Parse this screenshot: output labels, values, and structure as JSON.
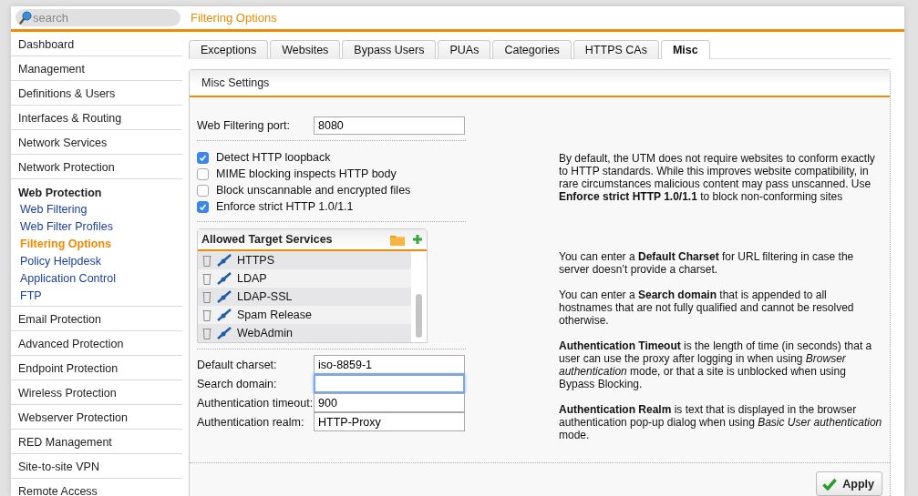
{
  "search": {
    "placeholder": "search"
  },
  "page_title": "Filtering Options",
  "sidebar": {
    "items": [
      {
        "label": "Dashboard",
        "expanded": false
      },
      {
        "label": "Management",
        "expanded": false
      },
      {
        "label": "Definitions & Users",
        "expanded": false
      },
      {
        "label": "Interfaces & Routing",
        "expanded": false
      },
      {
        "label": "Network Services",
        "expanded": false
      },
      {
        "label": "Network Protection",
        "expanded": false
      },
      {
        "label": "Web Protection",
        "expanded": true,
        "children": [
          {
            "label": "Web Filtering",
            "selected": false
          },
          {
            "label": "Web Filter Profiles",
            "selected": false
          },
          {
            "label": "Filtering Options",
            "selected": true
          },
          {
            "label": "Policy Helpdesk",
            "selected": false
          },
          {
            "label": "Application Control",
            "selected": false
          },
          {
            "label": "FTP",
            "selected": false
          }
        ]
      },
      {
        "label": "Email Protection",
        "expanded": false
      },
      {
        "label": "Advanced Protection",
        "expanded": false
      },
      {
        "label": "Endpoint Protection",
        "expanded": false
      },
      {
        "label": "Wireless Protection",
        "expanded": false
      },
      {
        "label": "Webserver Protection",
        "expanded": false
      },
      {
        "label": "RED Management",
        "expanded": false
      },
      {
        "label": "Site-to-site VPN",
        "expanded": false
      },
      {
        "label": "Remote Access",
        "expanded": false
      }
    ]
  },
  "tabs": [
    {
      "label": "Exceptions",
      "selected": false
    },
    {
      "label": "Websites",
      "selected": false
    },
    {
      "label": "Bypass Users",
      "selected": false
    },
    {
      "label": "PUAs",
      "selected": false
    },
    {
      "label": "Categories",
      "selected": false
    },
    {
      "label": "HTTPS CAs",
      "selected": false
    },
    {
      "label": "Misc",
      "selected": true
    }
  ],
  "panel": {
    "title": "Misc Settings",
    "port": {
      "label": "Web Filtering port:",
      "value": "8080"
    },
    "options": [
      {
        "label": "Detect HTTP loopback",
        "checked": true
      },
      {
        "label": "MIME blocking inspects HTTP body",
        "checked": false
      },
      {
        "label": "Block unscannable and encrypted files",
        "checked": false
      },
      {
        "label": "Enforce strict HTTP 1.0/1.1",
        "checked": true
      }
    ],
    "services": {
      "title": "Allowed Target Services",
      "items": [
        "HTTPS",
        "LDAP",
        "LDAP-SSL",
        "Spam Release",
        "WebAdmin"
      ]
    },
    "fields": [
      {
        "label": "Default charset:",
        "value": "iso-8859-1",
        "focused": false
      },
      {
        "label": "Search domain:",
        "focused": true
      },
      {
        "label": "Authentication timeout:",
        "value": "900",
        "focused": false
      },
      {
        "label": "Authentication realm:",
        "value": "HTTP-Proxy",
        "focused": false
      }
    ],
    "help": [
      "By default, the UTM does not require websites to conform exactly to HTTP standards. While this improves website compatibility, in rare circumstances malicious content may pass unscanned. Use **Enforce strict HTTP 1.0/1.1** to block non-conforming sites",
      "You can enter a **Default Charset** for URL filtering in case the server doesn’t provide a charset.",
      "You can enter a **Search domain** that is appended to all hostnames that are not fully qualified and cannot be resolved otherwise.",
      "**Authentication Timeout** is the length of time (in seconds) that a user can use the proxy after logging in when using *Browser authentication* mode, or that a site is unblocked when using Bypass Blocking.",
      "**Authentication Realm** is text that is displayed in the browser authentication pop-up dialog when using *Basic User authentication* mode."
    ],
    "apply": "Apply"
  }
}
